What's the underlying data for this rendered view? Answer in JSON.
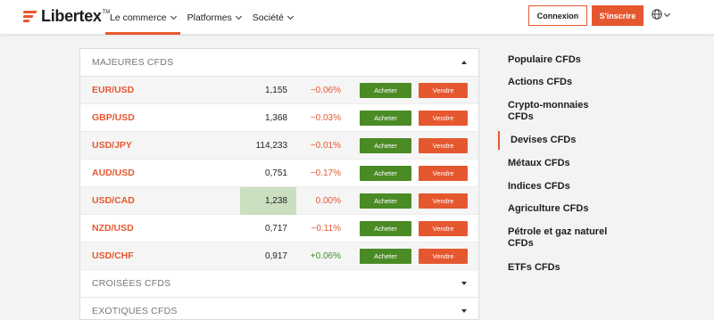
{
  "header": {
    "logo_text": "Libertex",
    "logo_tm": "TM",
    "nav": [
      {
        "label": "Le commerce",
        "active": true
      },
      {
        "label": "Platformes",
        "active": false
      },
      {
        "label": "Société",
        "active": false
      }
    ],
    "login_label": "Connexion",
    "signup_label": "S'inscrire",
    "language_icon": "globe-icon"
  },
  "markets": {
    "sections": [
      {
        "title": "MAJEURES CFDS",
        "expanded": true
      },
      {
        "title": "CROISÉES CFDS",
        "expanded": false
      },
      {
        "title": "EXOTIQUES CFDS",
        "expanded": false
      }
    ],
    "buy_label": "Acheter",
    "sell_label": "Vendre",
    "rows": [
      {
        "pair": "EUR/USD",
        "price": "1,155",
        "change": "−0.06%",
        "trend": "neg",
        "highlight": false
      },
      {
        "pair": "GBP/USD",
        "price": "1,368",
        "change": "−0.03%",
        "trend": "neg",
        "highlight": false
      },
      {
        "pair": "USD/JPY",
        "price": "114,233",
        "change": "−0.01%",
        "trend": "neg",
        "highlight": false
      },
      {
        "pair": "AUD/USD",
        "price": "0,751",
        "change": "−0.17%",
        "trend": "neg",
        "highlight": false
      },
      {
        "pair": "USD/CAD",
        "price": "1,238",
        "change": "0.00%",
        "trend": "zero",
        "highlight": true
      },
      {
        "pair": "NZD/USD",
        "price": "0,717",
        "change": "−0.11%",
        "trend": "neg",
        "highlight": false
      },
      {
        "pair": "USD/CHF",
        "price": "0,917",
        "change": "+0.06%",
        "trend": "pos",
        "highlight": false
      }
    ]
  },
  "sidebar": {
    "items": [
      {
        "label": "Populaire CFDs",
        "active": false
      },
      {
        "label": "Actions CFDs",
        "active": false
      },
      {
        "label": "Crypto-monnaies CFDs",
        "active": false
      },
      {
        "label": "Devises CFDs",
        "active": true
      },
      {
        "label": "Métaux CFDs",
        "active": false
      },
      {
        "label": "Indices CFDs",
        "active": false
      },
      {
        "label": "Agriculture CFDs",
        "active": false
      },
      {
        "label": "Pétrole et gaz naturel CFDs",
        "active": false
      },
      {
        "label": "ETFs CFDs",
        "active": false
      }
    ]
  },
  "colors": {
    "brand": "#e5582f",
    "buy": "#4b8b25",
    "positive": "#3f8f2a",
    "highlight": "#c9dfc0"
  }
}
